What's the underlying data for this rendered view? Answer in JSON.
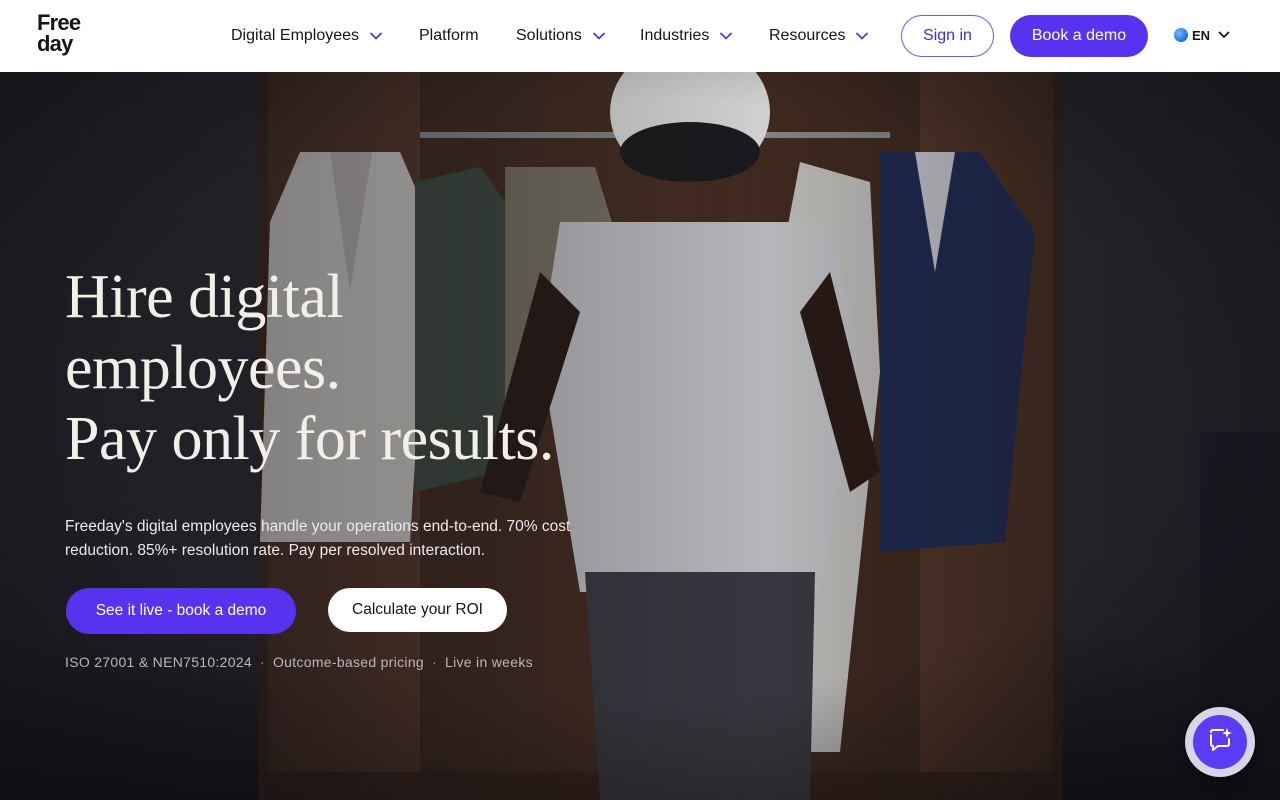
{
  "brand": {
    "logo_line1": "Free",
    "logo_line2": "day"
  },
  "nav": {
    "items": [
      {
        "label": "Digital Employees",
        "has_dropdown": true
      },
      {
        "label": "Platform",
        "has_dropdown": false
      },
      {
        "label": "Solutions",
        "has_dropdown": true
      },
      {
        "label": "Industries",
        "has_dropdown": true
      },
      {
        "label": "Resources",
        "has_dropdown": true
      }
    ],
    "signin_label": "Sign in",
    "demo_label": "Book a demo",
    "language": "EN",
    "icons": {
      "dropdown": "chevron-down-icon",
      "language": "globe-icon"
    }
  },
  "hero": {
    "headline": [
      "Hire digital",
      "employees.",
      "Pay only for results."
    ],
    "subtext": "Freeday's digital employees handle your operations end-to-end. 70% cost reduction. 85%+ resolution rate. Pay per resolved interaction.",
    "cta_primary": "See it live - book a demo",
    "cta_secondary": "Calculate your ROI",
    "trust": [
      "ISO 27001 & NEN7510:2024",
      "Outcome-based pricing",
      "Live in weeks"
    ],
    "trust_separator": "·"
  },
  "chat": {
    "icon": "chat-sparkle-icon"
  },
  "colors": {
    "accent": "#5733f0",
    "nav_bg": "#ffffff",
    "hero_text": "#f2efe9",
    "muted": "#b9b6bf"
  }
}
